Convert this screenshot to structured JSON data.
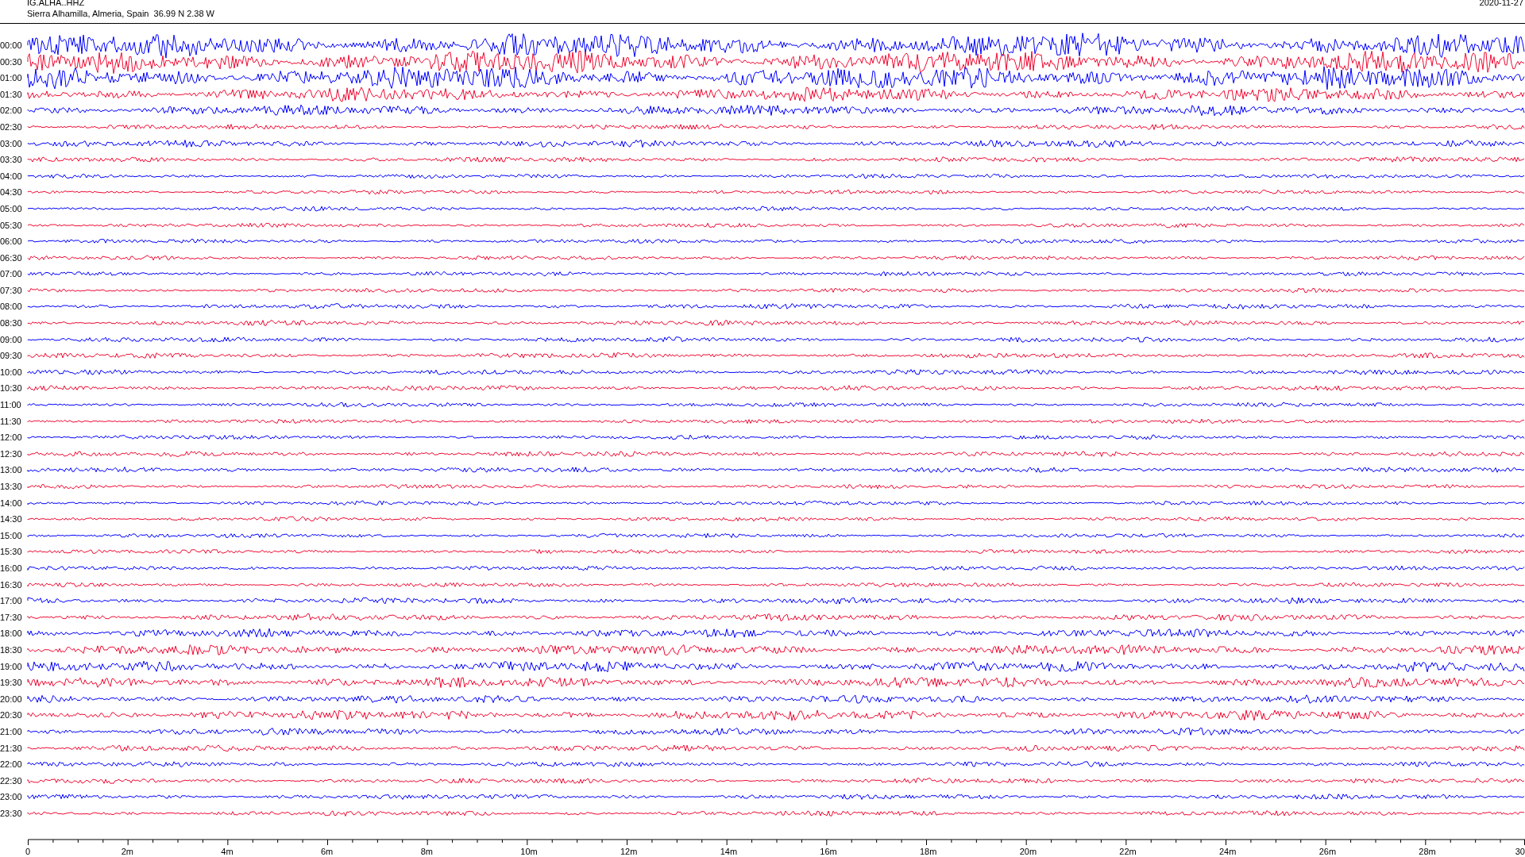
{
  "header": {
    "station": "IG.ALHA..HHZ",
    "location": "Sierra Alhamilla, Almeria, Spain  36.99 N 2.38 W",
    "date": "2020-11-27"
  },
  "traces": [
    {
      "time": "00:00",
      "color": "#0000ff"
    },
    {
      "time": "00:30",
      "color": "#f00a32"
    },
    {
      "time": "01:00",
      "color": "#0000ff"
    },
    {
      "time": "01:30",
      "color": "#f00a32"
    },
    {
      "time": "02:00",
      "color": "#0000ff"
    },
    {
      "time": "02:30",
      "color": "#f00a32"
    },
    {
      "time": "03:00",
      "color": "#0000ff"
    },
    {
      "time": "03:30",
      "color": "#f00a32"
    },
    {
      "time": "04:00",
      "color": "#0000ff"
    },
    {
      "time": "04:30",
      "color": "#f00a32"
    },
    {
      "time": "05:00",
      "color": "#0000ff"
    },
    {
      "time": "05:30",
      "color": "#f00a32"
    },
    {
      "time": "06:00",
      "color": "#0000ff"
    },
    {
      "time": "06:30",
      "color": "#f00a32"
    },
    {
      "time": "07:00",
      "color": "#0000ff"
    },
    {
      "time": "07:30",
      "color": "#f00a32"
    },
    {
      "time": "08:00",
      "color": "#0000ff"
    },
    {
      "time": "08:30",
      "color": "#f00a32"
    },
    {
      "time": "09:00",
      "color": "#0000ff"
    },
    {
      "time": "09:30",
      "color": "#f00a32"
    },
    {
      "time": "10:00",
      "color": "#0000ff"
    },
    {
      "time": "10:30",
      "color": "#f00a32"
    },
    {
      "time": "11:00",
      "color": "#0000ff"
    },
    {
      "time": "11:30",
      "color": "#f00a32"
    },
    {
      "time": "12:00",
      "color": "#0000ff"
    },
    {
      "time": "12:30",
      "color": "#f00a32"
    },
    {
      "time": "13:00",
      "color": "#0000ff"
    },
    {
      "time": "13:30",
      "color": "#f00a32"
    },
    {
      "time": "14:00",
      "color": "#0000ff"
    },
    {
      "time": "14:30",
      "color": "#f00a32"
    },
    {
      "time": "15:00",
      "color": "#0000ff"
    },
    {
      "time": "15:30",
      "color": "#f00a32"
    },
    {
      "time": "16:00",
      "color": "#0000ff"
    },
    {
      "time": "16:30",
      "color": "#f00a32"
    },
    {
      "time": "17:00",
      "color": "#0000ff"
    },
    {
      "time": "17:30",
      "color": "#f00a32"
    },
    {
      "time": "18:00",
      "color": "#0000ff"
    },
    {
      "time": "18:30",
      "color": "#f00a32"
    },
    {
      "time": "19:00",
      "color": "#0000ff"
    },
    {
      "time": "19:30",
      "color": "#f00a32"
    },
    {
      "time": "20:00",
      "color": "#0000ff"
    },
    {
      "time": "20:30",
      "color": "#f00a32"
    },
    {
      "time": "21:00",
      "color": "#0000ff"
    },
    {
      "time": "21:30",
      "color": "#f00a32"
    },
    {
      "time": "22:00",
      "color": "#0000ff"
    },
    {
      "time": "22:30",
      "color": "#f00a32"
    },
    {
      "time": "23:00",
      "color": "#0000ff"
    },
    {
      "time": "23:30",
      "color": "#f00a32"
    }
  ],
  "x_axis": {
    "ticks": [
      "0",
      "2m",
      "4m",
      "6m",
      "8m",
      "10m",
      "12m",
      "14m",
      "16m",
      "18m",
      "20m",
      "22m",
      "24m",
      "26m",
      "28m",
      "30"
    ]
  }
}
